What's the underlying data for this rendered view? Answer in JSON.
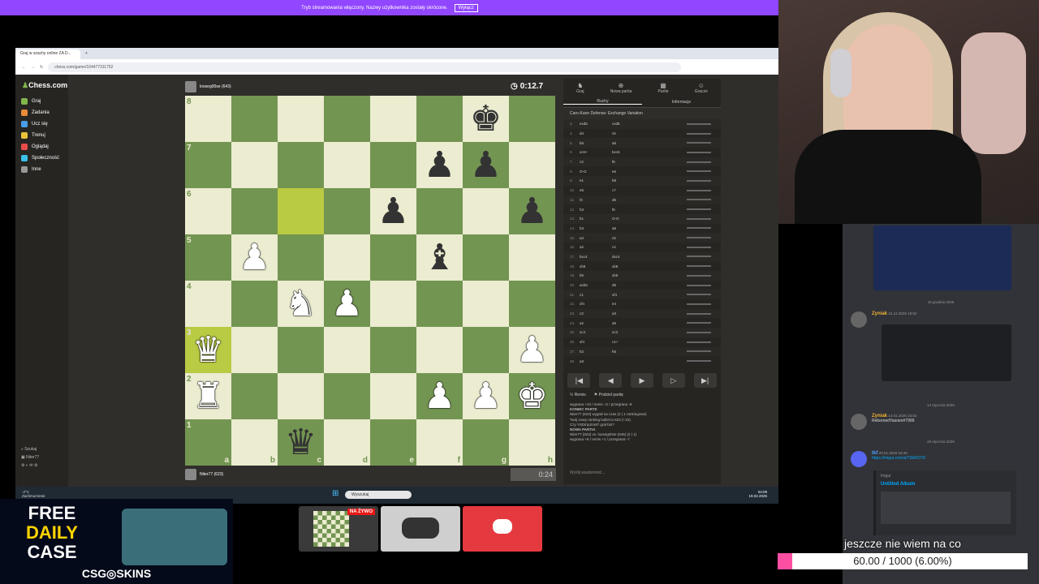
{
  "banner": {
    "text": "Tryb streamowania włączony. Nazwy użytkownika zostały skrócone.",
    "button": "Wyłącz"
  },
  "browser": {
    "tab_title": "Graj w szachy online ZA D...",
    "url": "chess.com/game/164477311752"
  },
  "sidebar": {
    "logo_main": "Chess",
    "logo_suffix": ".com",
    "items": [
      {
        "label": "Graj",
        "color": "#81b64c"
      },
      {
        "label": "Zadania",
        "color": "#e98a3a"
      },
      {
        "label": "Ucz się",
        "color": "#4a9ee9"
      },
      {
        "label": "Trenuj",
        "color": "#e9c23a"
      },
      {
        "label": "Oglądaj",
        "color": "#e94a4a"
      },
      {
        "label": "Społeczność",
        "color": "#3ac1e9"
      },
      {
        "label": "Inne",
        "color": "#999999"
      }
    ],
    "search": "Szukaj",
    "user": "Niter77"
  },
  "game": {
    "top_player": "looseg00se (643)",
    "top_clock": "0:12.7",
    "bottom_player": "Niter77 (623)",
    "bottom_clock": "0:24",
    "ranks": [
      "8",
      "7",
      "6",
      "5",
      "4",
      "3",
      "2",
      "1"
    ],
    "files": [
      "a",
      "b",
      "c",
      "d",
      "e",
      "f",
      "g",
      "h"
    ],
    "board": [
      [
        "",
        "",
        "",
        "",
        "",
        "",
        "k",
        ""
      ],
      [
        "",
        "",
        "",
        "",
        "",
        "p",
        "p",
        ""
      ],
      [
        "",
        "",
        "",
        "",
        "p",
        "",
        "",
        "p"
      ],
      [
        "",
        "P",
        "",
        "",
        "",
        "b",
        "",
        ""
      ],
      [
        "",
        "",
        "N",
        "P",
        "",
        "",
        "",
        ""
      ],
      [
        "Q",
        "",
        "",
        "",
        "",
        "",
        "",
        "P"
      ],
      [
        "R",
        "",
        "",
        "",
        "",
        "P",
        "P",
        "K"
      ],
      [
        "",
        "",
        "q",
        "",
        "",
        "",
        "",
        ""
      ]
    ],
    "highlights": [
      "c6",
      "a3"
    ]
  },
  "panel": {
    "tabs": [
      "Graj",
      "Nowa partia",
      "Partie",
      "Gracze"
    ],
    "subtabs": [
      "Ruchy",
      "Informacje"
    ],
    "opening": "Caro-Kann Defense: Exchange Variation",
    "moves": [
      {
        "n": "3.",
        "w": "exd5",
        "b": "cxd5"
      },
      {
        "n": "4.",
        "w": "d4",
        "b": "c6"
      },
      {
        "n": "5.",
        "w": "b5",
        "b": "a6"
      },
      {
        "n": "6.",
        "w": "xc6+",
        "b": "bxc6"
      },
      {
        "n": "7.",
        "w": "c3",
        "b": "f6"
      },
      {
        "n": "8.",
        "w": "O-O",
        "b": "e6"
      },
      {
        "n": "9.",
        "w": "e1",
        "b": "b8"
      },
      {
        "n": "10.",
        "w": "e5",
        "b": "c7"
      },
      {
        "n": "11.",
        "w": "f4",
        "b": "d6"
      },
      {
        "n": "12.",
        "w": "h3",
        "b": "f6"
      },
      {
        "n": "13.",
        "w": "b1",
        "b": "O-O"
      },
      {
        "n": "14.",
        "w": "b3",
        "b": "a5"
      },
      {
        "n": "15.",
        "w": "a4",
        "b": "c5"
      },
      {
        "n": "16.",
        "w": "a2",
        "b": "c4"
      },
      {
        "n": "17.",
        "w": "bxc4",
        "b": "dxc4"
      },
      {
        "n": "18.",
        "w": "xb8",
        "b": "xb8"
      },
      {
        "n": "19.",
        "w": "b5",
        "b": "xb5"
      },
      {
        "n": "20.",
        "w": "axb5",
        "b": "d5"
      },
      {
        "n": "21.",
        "w": "c1",
        "b": "xf4"
      },
      {
        "n": "22.",
        "w": "xf4",
        "b": "e4"
      },
      {
        "n": "23.",
        "w": "c3",
        "b": "a3"
      },
      {
        "n": "24.",
        "w": "a2",
        "b": "a5"
      },
      {
        "n": "25.",
        "w": "xc4",
        "b": "xc3"
      },
      {
        "n": "26.",
        "w": "xf4",
        "b": "c1+"
      },
      {
        "n": "27.",
        "w": "h2",
        "b": "h6"
      },
      {
        "n": "28.",
        "w": "a3",
        "b": ""
      }
    ],
    "controls": [
      "|◀",
      "◀",
      "▶",
      "▷",
      "▶|"
    ],
    "remis": "Remis",
    "share": "Podziel partię",
    "chat": [
      "wygrana +10 / remis +2 / przegrana -8",
      "KONIEC PARTII",
      "Niter77 (623) wygrał na czas (2 | 1 rankingowe)",
      "Twój nowy ranking bullet to 623 (+10).",
      "Czy YSDirtyJim87 grał fair?",
      "NOWA PARTIA",
      "Niter77 (623) vs. looseg00se (645) (2 | 1)",
      "wygrana +9 / remis +1 / przegrana -7"
    ],
    "message_placeholder": "Wyślij wiadomość..."
  },
  "taskbar": {
    "search": "Wyszukaj",
    "time": "04:09",
    "date": "19.02.2026",
    "weather_temp": "-2°C",
    "weather_text": "Zachmurzenie"
  },
  "discord": {
    "messages": [
      {
        "name": "Zyniak",
        "date": "16.12.2025 18:52",
        "text": ""
      },
      {
        "name": "Zyniak",
        "date": "14.01.2026 23:53",
        "text": "RebornedYasoen#7999"
      },
      {
        "name": "tkf",
        "date": "20.01.2026 03:48",
        "text": "https://imgur.com/a/T3kROTD"
      }
    ],
    "separators": [
      "16 grudnia 2025",
      "14 stycznia 2026",
      "20 stycznia 2026"
    ],
    "embed_source": "Imgur",
    "embed_title": "Untitled Album"
  },
  "ad": {
    "line1": "FREE",
    "line2": "DAILY",
    "line3": "CASE",
    "brand": "CSG◎SKINS"
  },
  "live_badge": "NA ŻYWO",
  "goal": {
    "text": "jeszcze nie wiem na co",
    "value": "60.00 / 1000 (6.00%)",
    "fraction": 0.06
  }
}
